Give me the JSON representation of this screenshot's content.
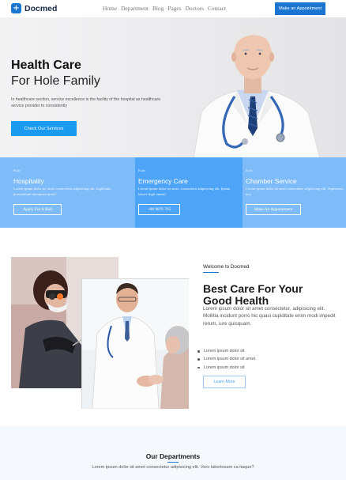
{
  "brand": {
    "name": "Docmed",
    "logo_glyph": "+",
    "primary_color": "#1a76d1",
    "accent_color": "#1a9bf0"
  },
  "nav": {
    "items": [
      "Home",
      "Department",
      "Blog",
      "Pages",
      "Doctors",
      "Contact"
    ],
    "appointment_label": "Make an Appointment"
  },
  "hero": {
    "title": "Health Care",
    "subtitle": "For Hole Family",
    "description": "In healthcare section, service excellence is the facility of the hospital as healthcare service provider to consistently",
    "button_label": "Check Our Services"
  },
  "services": [
    {
      "tag": "Ecitc",
      "title": "Hospitality",
      "text": "Lorem ipsum dolor sit, amet consectetur adipisicing elit. Explicabo praesentium numquam quod?",
      "button": "Apply For A Bed"
    },
    {
      "tag": "Ecitc",
      "title": "Emergency Care",
      "text": "Lorem ipsum dolor sit amet, consectetur adipisicing elit. Ipsum labore fugit omnis!",
      "button": "+88 9876 765"
    },
    {
      "tag": "Ecitc",
      "title": "Chamber Service",
      "text": "Lorem ipsum dolor sit amet consectetur adipisicing elit. Asperiores, nos.",
      "button": "Make An Appointment"
    }
  ],
  "about": {
    "welcome": "Welcome to Docmed",
    "title": "Best Care For Your Good Health",
    "text": "Lorem ipsum dolor sit amet consectetur, adipisicing elit. Mollitia incidunt porro hic quasi cupiditate enim modi impedit rerum, iure quisquam.",
    "list": [
      "Lorem ipsum dolor sit",
      "Lorem ipsum dolor sit amet.",
      "Lorem ipsum dolor sit"
    ],
    "button_label": "Learn More"
  },
  "departments": {
    "title": "Our Departments",
    "text": "Lorem ipsum dolor sit amet consectetur adipisicing elit. Voro laborlosam ca itaque?"
  }
}
